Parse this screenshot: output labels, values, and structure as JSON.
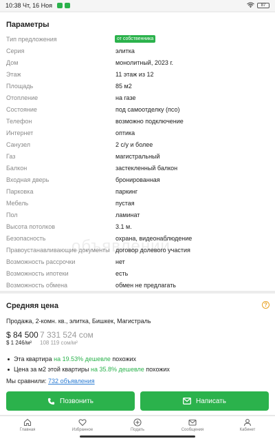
{
  "status_bar": {
    "time": "10:38 Чт, 16 Ноя",
    "battery": "87"
  },
  "params": {
    "title": "Параметры",
    "rows": [
      {
        "label": "Тип предложения",
        "value": "от собственника",
        "badge": true
      },
      {
        "label": "Серия",
        "value": "элитка"
      },
      {
        "label": "Дом",
        "value": "монолитный, 2023 г."
      },
      {
        "label": "Этаж",
        "value": "11 этаж из 12"
      },
      {
        "label": "Площадь",
        "value": "85 м2"
      },
      {
        "label": "Отопление",
        "value": "на газе"
      },
      {
        "label": "Состояние",
        "value": "под самоотделку (псо)"
      },
      {
        "label": "Телефон",
        "value": "возможно подключение"
      },
      {
        "label": "Интернет",
        "value": "оптика"
      },
      {
        "label": "Санузел",
        "value": "2 с/у и более"
      },
      {
        "label": "Газ",
        "value": "магистральный"
      },
      {
        "label": "Балкон",
        "value": "застекленный балкон"
      },
      {
        "label": "Входная дверь",
        "value": "бронированная"
      },
      {
        "label": "Парковка",
        "value": "паркинг"
      },
      {
        "label": "Мебель",
        "value": "пустая"
      },
      {
        "label": "Пол",
        "value": "ламинат"
      },
      {
        "label": "Высота потолков",
        "value": "3.1 м."
      },
      {
        "label": "Безопасность",
        "value": "охрана, видеонаблюдение"
      },
      {
        "label": "Правоустанавливающие документы",
        "value": "договор долевого участия"
      },
      {
        "label": "Возможность рассрочки",
        "value": "нет"
      },
      {
        "label": "Возможность ипотеки",
        "value": "есть"
      },
      {
        "label": "Возможность обмена",
        "value": "обмен не предлагать"
      }
    ],
    "watermark": "объявлений"
  },
  "avg_price": {
    "title": "Средняя цена",
    "subtitle": "Продажа, 2-комн. кв., элитка, Бишкек, Магистраль",
    "usd": "$ 84 500",
    "usd_per_m2": "$ 1 246/м²",
    "som": "7 331 524 сом",
    "som_per_m2": "108 119 сом/м²",
    "compare1": {
      "prefix": "Эта квартира ",
      "highlight": "на 19.53% дешевле",
      "suffix": " похожих"
    },
    "compare2": {
      "prefix": "Цена за м2 этой квартиры ",
      "highlight": "на 35.8% дешевле",
      "suffix": " похожих"
    },
    "compared": {
      "prefix": "Мы сравнили: ",
      "link": "732 объявления"
    }
  },
  "actions": {
    "call": "Позвонить",
    "write": "Написать"
  },
  "nav": {
    "items": [
      {
        "label": "Главная"
      },
      {
        "label": "Избранное"
      },
      {
        "label": "Подать"
      },
      {
        "label": "Сообщения"
      },
      {
        "label": "Кабинет"
      }
    ]
  },
  "colors": {
    "accent": "#2bb24c",
    "link": "#2b7cd3",
    "warning": "#e8a020"
  }
}
